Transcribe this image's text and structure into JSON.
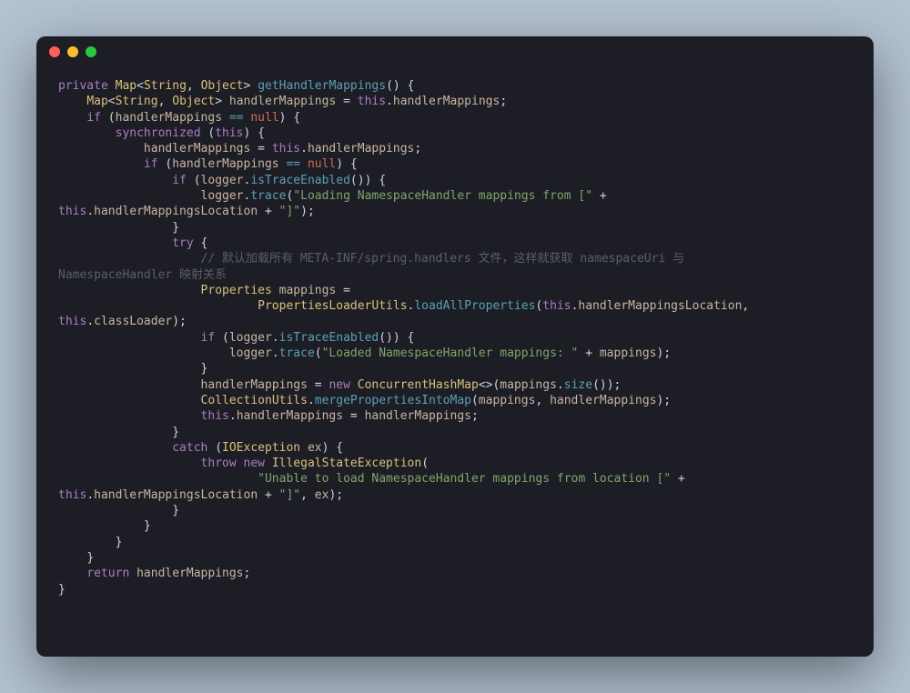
{
  "lang": "java",
  "window": {
    "traffic_light_close_color": "#ff5f56",
    "traffic_light_minimize_color": "#ffbd2e",
    "traffic_light_zoom_color": "#27c93f",
    "background": "#1d1d25",
    "page_background": "#b3c1d1"
  },
  "code": {
    "L01_kw_private": "private",
    "L01_type_map": "Map",
    "L01_generic_open": "<",
    "L01_type_string": "String",
    "L01_comma": ", ",
    "L01_type_object": "Object",
    "L01_generic_close": ">",
    "L01_fn_name": "getHandlerMappings",
    "L01_tail": "() {",
    "L02_indent": "    ",
    "L02_type_map": "Map",
    "L02_generic": "<",
    "L02_type_string": "String",
    "L02_comma": ", ",
    "L02_type_object": "Object",
    "L02_generic_close": "> ",
    "L02_ident": "handlerMappings",
    "L02_eq": " = ",
    "L02_this": "this",
    "L02_dot": ".",
    "L02_field": "handlerMappings",
    "L02_semi": ";",
    "L03_indent": "    ",
    "L03_if": "if",
    "L03_open": " (",
    "L03_ident": "handlerMappings",
    "L03_op": " == ",
    "L03_null": "null",
    "L03_tail": ") {",
    "L04_indent": "        ",
    "L04_sync": "synchronized",
    "L04_open": " (",
    "L04_this": "this",
    "L04_tail": ") {",
    "L05_indent": "            ",
    "L05_ident": "handlerMappings",
    "L05_eq": " = ",
    "L05_this": "this",
    "L05_dot": ".",
    "L05_field": "handlerMappings",
    "L05_semi": ";",
    "L06_indent": "            ",
    "L06_if": "if",
    "L06_open": " (",
    "L06_ident": "handlerMappings",
    "L06_op": " == ",
    "L06_null": "null",
    "L06_tail": ") {",
    "L07_indent": "                ",
    "L07_if": "if",
    "L07_open": " (",
    "L07_ident": "logger",
    "L07_dot": ".",
    "L07_fn": "isTraceEnabled",
    "L07_tail": "()) {",
    "L08_indent": "                    ",
    "L08_ident": "logger",
    "L08_dot": ".",
    "L08_fn": "trace",
    "L08_open": "(",
    "L08_str": "\"Loading NamespaceHandler mappings from [\"",
    "L08_plus": " + ",
    "L09_this": "this",
    "L09_dot": ".",
    "L09_field": "handlerMappingsLocation",
    "L09_plus": " + ",
    "L09_str": "\"]\"",
    "L09_tail": ");",
    "L10_indent": "                ",
    "L10_brace": "}",
    "L11_indent": "                ",
    "L11_try": "try",
    "L11_brace": " {",
    "L12_indent": "                    ",
    "L12_cmt": "// 默认加载所有 META-INF/spring.handlers 文件，这样就获取 namespaceUri 与 ",
    "L12b_cmt": "NamespaceHandler 映射关系",
    "L13_indent": "                    ",
    "L13_type": "Properties",
    "L13_ident": " mappings",
    "L13_eq": " =",
    "L14_indent": "                            ",
    "L14_type": "PropertiesLoaderUtils",
    "L14_dot": ".",
    "L14_fn": "loadAllProperties",
    "L14_open": "(",
    "L14_this": "this",
    "L14_dot2": ".",
    "L14_field": "handlerMappingsLocation",
    "L14_comma": ", ",
    "L14b_this": "this",
    "L14b_dot": ".",
    "L14b_field": "classLoader",
    "L14b_tail": ");",
    "L15_indent": "                    ",
    "L15_if": "if",
    "L15_open": " (",
    "L15_ident": "logger",
    "L15_dot": ".",
    "L15_fn": "isTraceEnabled",
    "L15_tail": "()) {",
    "L16_indent": "                        ",
    "L16_ident": "logger",
    "L16_dot": ".",
    "L16_fn": "trace",
    "L16_open": "(",
    "L16_str": "\"Loaded NamespaceHandler mappings: \"",
    "L16_plus": " + ",
    "L16_ident2": "mappings",
    "L16_tail": ");",
    "L17_indent": "                    ",
    "L17_brace": "}",
    "L18_indent": "                    ",
    "L18_ident": "handlerMappings",
    "L18_eq": " = ",
    "L18_new": "new",
    "L18_sp": " ",
    "L18_type": "ConcurrentHashMap",
    "L18_diamond": "<>",
    "L18_open": "(",
    "L18_ident2": "mappings",
    "L18_dot": ".",
    "L18_fn": "size",
    "L18_tail": "());",
    "L19_indent": "                    ",
    "L19_type": "CollectionUtils",
    "L19_dot": ".",
    "L19_fn": "mergePropertiesIntoMap",
    "L19_open": "(",
    "L19_ident": "mappings",
    "L19_comma": ", ",
    "L19_ident2": "handlerMappings",
    "L19_tail": ");",
    "L20_indent": "                    ",
    "L20_this": "this",
    "L20_dot": ".",
    "L20_field": "handlerMappings",
    "L20_eq": " = ",
    "L20_ident": "handlerMappings",
    "L20_semi": ";",
    "L21_indent": "                ",
    "L21_brace": "}",
    "L22_indent": "                ",
    "L22_catch": "catch",
    "L22_open": " (",
    "L22_type": "IOException",
    "L22_ident": " ex",
    "L22_tail": ") {",
    "L23_indent": "                    ",
    "L23_throw": "throw",
    "L23_sp": " ",
    "L23_new": "new",
    "L23_sp2": " ",
    "L23_type": "IllegalStateException",
    "L23_open": "(",
    "L24_indent": "                            ",
    "L24_str": "\"Unable to load NamespaceHandler mappings from location [\"",
    "L24_plus": " + ",
    "L25_this": "this",
    "L25_dot": ".",
    "L25_field": "handlerMappingsLocation",
    "L25_plus": " + ",
    "L25_str": "\"]\"",
    "L25_comma": ", ",
    "L25_ident": "ex",
    "L25_tail": ");",
    "L26_indent": "                ",
    "L26_brace": "}",
    "L27_indent": "            ",
    "L27_brace": "}",
    "L28_indent": "        ",
    "L28_brace": "}",
    "L29_indent": "    ",
    "L29_brace": "}",
    "L30_indent": "    ",
    "L30_return": "return",
    "L30_ident": " handlerMappings",
    "L30_semi": ";",
    "L31_brace": "}"
  }
}
